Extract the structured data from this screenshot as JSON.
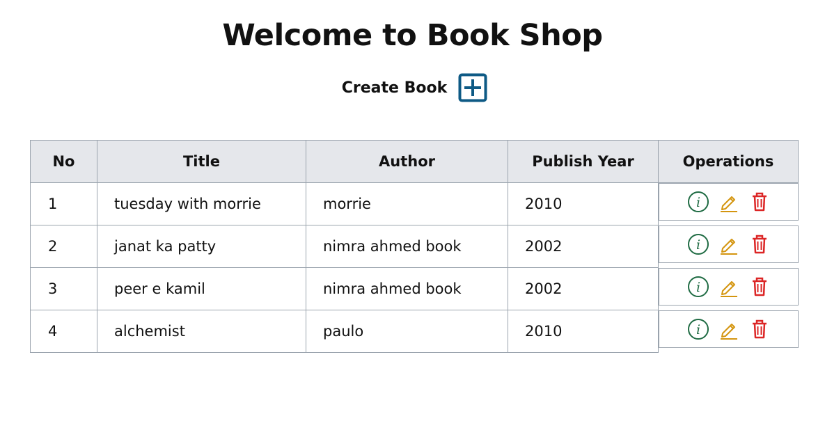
{
  "header": {
    "title": "Welcome to Book Shop",
    "create_label": "Create Book",
    "create_icon": "plus-square-icon",
    "create_icon_color": "#0e5a85"
  },
  "table": {
    "columns": [
      "No",
      "Title",
      "Author",
      "Publish Year",
      "Operations"
    ],
    "rows": [
      {
        "no": "1",
        "title": "tuesday with morrie",
        "author": "morrie",
        "year": "2010"
      },
      {
        "no": "2",
        "title": "janat ka patty",
        "author": "nimra ahmed book",
        "year": "2002"
      },
      {
        "no": "3",
        "title": "peer e kamil",
        "author": "nimra ahmed book",
        "year": "2002"
      },
      {
        "no": "4",
        "title": "alchemist",
        "author": "paulo",
        "year": "2010"
      }
    ],
    "operations": [
      {
        "icon": "info-circle-icon",
        "color": "#1f6b43"
      },
      {
        "icon": "pencil-edit-icon",
        "color": "#d4950f"
      },
      {
        "icon": "trash-icon",
        "color": "#dc2626"
      }
    ]
  }
}
